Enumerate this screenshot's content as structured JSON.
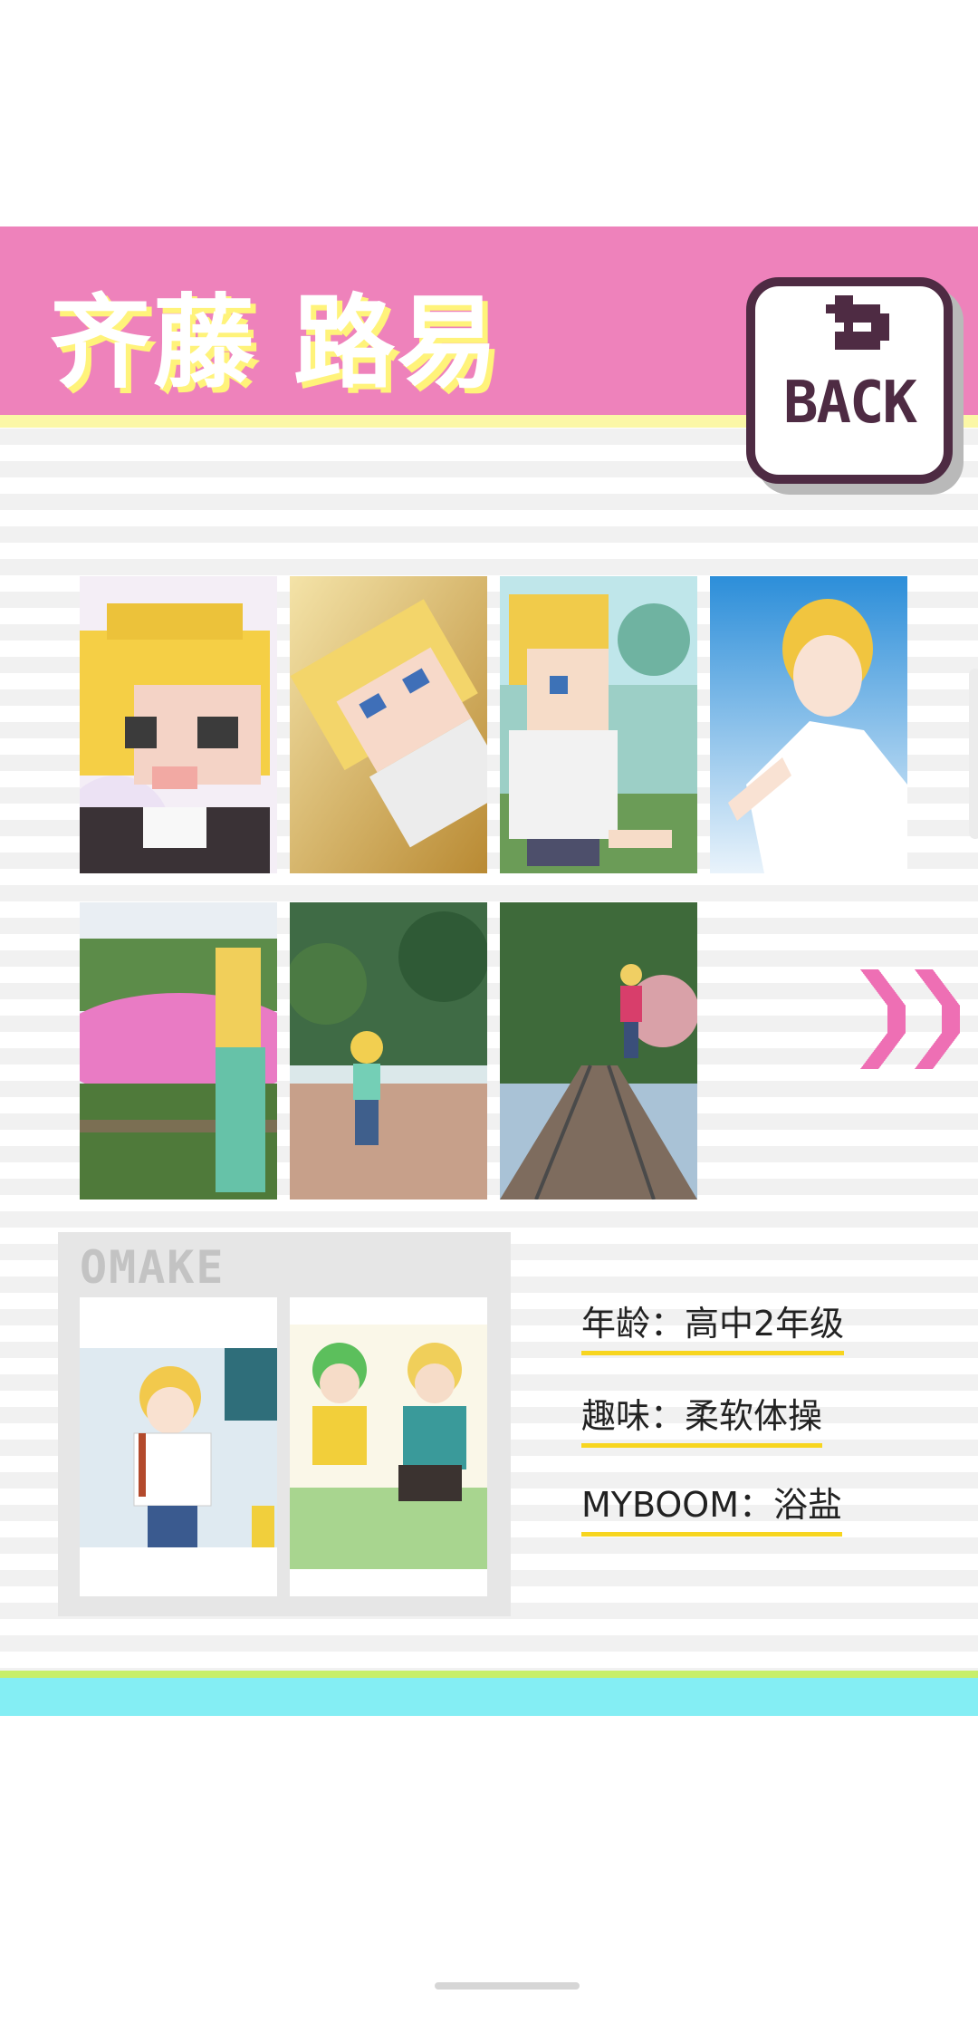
{
  "header": {
    "title": "齐藤 路易",
    "back_label": "BACK"
  },
  "colors": {
    "header_pink": "#ee82bb",
    "title_shadow": "#fff37a",
    "back_border": "#4e2b43",
    "underline": "#f7d51f",
    "cyan": "#84eef4"
  },
  "gallery": {
    "items": [
      {
        "name": "pixel-closeup"
      },
      {
        "name": "pixel-lying"
      },
      {
        "name": "pixel-waving"
      },
      {
        "name": "anime-sky"
      },
      {
        "name": "flower-field"
      },
      {
        "name": "park-plaza"
      },
      {
        "name": "railway-tracks"
      }
    ],
    "next_icon": "double-chevron-right-icon"
  },
  "omake": {
    "label": "OMAKE",
    "items": [
      {
        "name": "selfie-suitcase"
      },
      {
        "name": "two-friends-gaming"
      }
    ]
  },
  "profile": {
    "age": "年龄：高中2年级",
    "hobby": "趣味：柔软体操",
    "myboom": "MYBOOM：浴盐"
  }
}
